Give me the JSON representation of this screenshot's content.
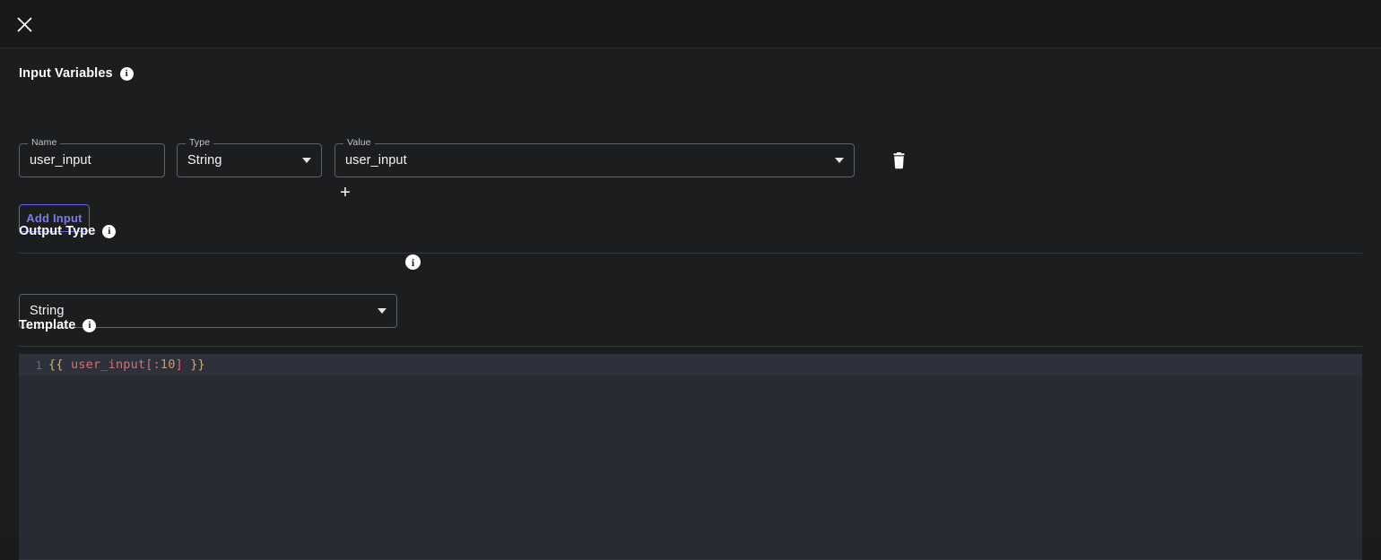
{
  "window": {
    "background_color": "#1b1d1f",
    "accent_color": "#6161e6"
  },
  "header": {
    "close_icon": "close-icon",
    "close_label": "Close"
  },
  "input_variables": {
    "title": "Input Variables",
    "info_tooltip_icon": "info-icon",
    "columns": {
      "name_legend": "Name",
      "type_legend": "Type",
      "value_legend": "Value"
    },
    "rows": [
      {
        "name": "user_input",
        "type": "String",
        "value": "user_input",
        "delete_icon": "trash-icon"
      }
    ],
    "add_row_icon": "plus-icon",
    "add_input_label": "Add Input"
  },
  "output_type": {
    "title": "Output Type",
    "info_tooltip_icon": "info-icon",
    "selected": "String",
    "trailing_info_icon": "info-icon"
  },
  "template": {
    "title": "Template",
    "info_tooltip_icon": "info-icon",
    "editor": {
      "line_number": "1",
      "code": "{{ user_input[:10] }}",
      "tokens": {
        "open_brace": "{{",
        "space_1": " ",
        "variable": "user_input",
        "bracket_open": "[:",
        "number": "10",
        "bracket_close": "]",
        "space_2": " ",
        "close_brace": "}}"
      }
    }
  }
}
